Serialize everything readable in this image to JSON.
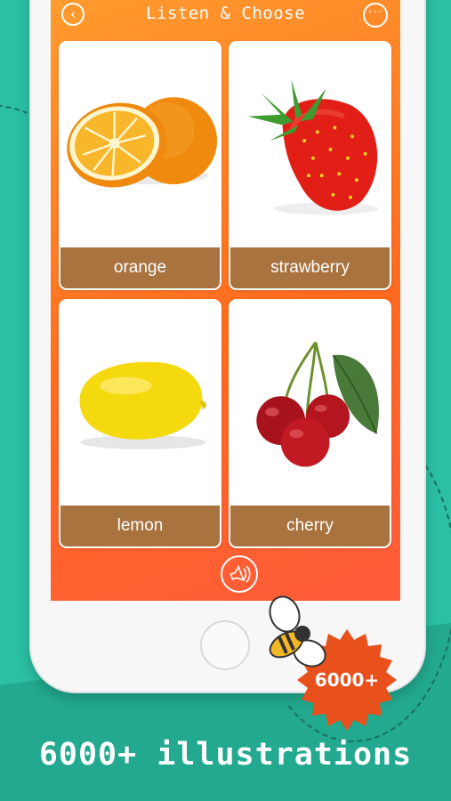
{
  "header": {
    "title": "Listen & Choose",
    "back_icon": "chevron-left-icon",
    "more_icon": "more-icon",
    "more_glyph": "···"
  },
  "cards": [
    {
      "label": "orange",
      "image": "orange-image"
    },
    {
      "label": "strawberry",
      "image": "strawberry-image"
    },
    {
      "label": "lemon",
      "image": "lemon-image"
    },
    {
      "label": "cherry",
      "image": "cherry-image"
    }
  ],
  "speaker_icon": "speaker-icon",
  "badge": {
    "text": "6000+",
    "color": "#e8501c"
  },
  "caption": "6000+ illustrations",
  "colors": {
    "background": "#2bbfa4",
    "screen_gradient_start": "#ff9b2e",
    "screen_gradient_end": "#ff5a3a",
    "label_bar": "#a8733f"
  }
}
